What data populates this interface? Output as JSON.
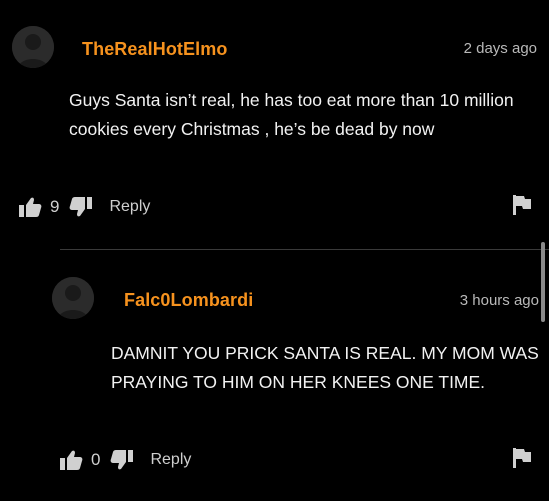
{
  "colors": {
    "background": "#000000",
    "username": "#f6921e",
    "text": "#f2f2f2",
    "muted": "#b9b9b9",
    "icon": "#d0d0d0"
  },
  "comments": [
    {
      "username": "TheRealHotElmo",
      "timestamp": "2 days ago",
      "text": "Guys Santa isn’t real, he has too eat more than 10 million cookies every Christmas , he’s be dead by now",
      "upvotes": "9",
      "reply_label": "Reply",
      "avatar_icon": "avatar-icon",
      "like_icon": "thumbs-up-icon",
      "dislike_icon": "thumbs-down-icon",
      "flag_icon": "flag-icon"
    },
    {
      "username": "Falc0Lombardi",
      "timestamp": "3 hours ago",
      "text": "DAMNIT YOU PRICK SANTA IS REAL. MY MOM WAS PRAYING TO HIM ON HER KNEES ONE TIME.",
      "upvotes": "0",
      "reply_label": "Reply",
      "avatar_icon": "avatar-icon",
      "like_icon": "thumbs-up-icon",
      "dislike_icon": "thumbs-down-icon",
      "flag_icon": "flag-icon"
    }
  ]
}
